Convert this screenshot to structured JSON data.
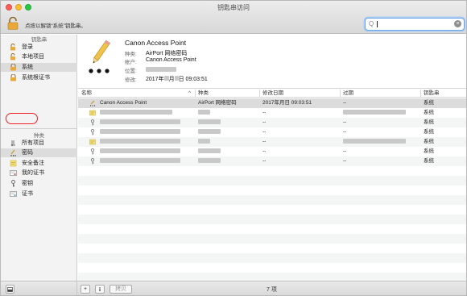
{
  "window": {
    "title": "钥匙串访问"
  },
  "toolbar": {
    "lock_hint": "点按以解锁“系统”钥匙串。",
    "search_placeholder": "Q"
  },
  "sidebar": {
    "keychains_header": "钥匙串",
    "keychains": [
      {
        "label": "登录",
        "icon": "lock-open-icon"
      },
      {
        "label": "本地项目",
        "icon": "lock-open-icon"
      },
      {
        "label": "系统",
        "icon": "lock-closed-icon",
        "selected": true
      },
      {
        "label": "系统根证书",
        "icon": "lock-closed-icon"
      }
    ],
    "categories_header": "种类",
    "categories": [
      {
        "label": "所有项目",
        "icon": "all-items-icon"
      },
      {
        "label": "密码",
        "icon": "password-icon",
        "selected": true,
        "highlighted": true
      },
      {
        "label": "安全备注",
        "icon": "note-icon"
      },
      {
        "label": "我的证书",
        "icon": "certificate-icon"
      },
      {
        "label": "密钥",
        "icon": "key-icon"
      },
      {
        "label": "证书",
        "icon": "certificate-icon"
      }
    ]
  },
  "detail": {
    "name": "Canon Access Point",
    "kind_label": "种类:",
    "kind_value": "AirPort 网络密码",
    "account_label": "帐户:",
    "account_value": "Canon Access Point",
    "location_label": "位置:",
    "modified_label": "修改:",
    "modified_value_prefix": "2017年",
    "modified_value_month": "月",
    "modified_value_suffix": "日 09:03:51"
  },
  "table": {
    "headers": {
      "name": "名称",
      "sort_indicator": "^",
      "kind": "种类",
      "modified": "修改日期",
      "expires": "过期",
      "keychain": "钥匙串"
    },
    "rows": [
      {
        "name": "Canon Access Point",
        "kind": "AirPort 网络密码",
        "modified": "2017年月日 09:03:51",
        "expires": "--",
        "keychain": "系统",
        "icon": "pencil-icon"
      },
      {
        "name": "",
        "kind": "",
        "modified": "--",
        "expires": "",
        "keychain": "系统",
        "icon": "certificate-icon"
      },
      {
        "name": "",
        "kind": "",
        "modified": "--",
        "expires": "--",
        "keychain": "系统",
        "icon": "key-icon"
      },
      {
        "name": "",
        "kind": "",
        "modified": "--",
        "expires": "--",
        "keychain": "系统",
        "icon": "key-icon"
      },
      {
        "name": "",
        "kind": "",
        "modified": "--",
        "expires": "",
        "keychain": "系统",
        "icon": "certificate-icon"
      },
      {
        "name": "",
        "kind": "",
        "modified": "--",
        "expires": "--",
        "keychain": "系统",
        "icon": "key-icon"
      },
      {
        "name": "",
        "kind": "",
        "modified": "--",
        "expires": "--",
        "keychain": "系统",
        "icon": "key-icon"
      }
    ]
  },
  "bottombar": {
    "add": "+",
    "info": "i",
    "copy": "拷贝",
    "count": "7 项"
  },
  "colors": {
    "selection": "#dcdcdc",
    "highlight_ring": "#e22222",
    "search_focus": "#6aa4e8"
  }
}
